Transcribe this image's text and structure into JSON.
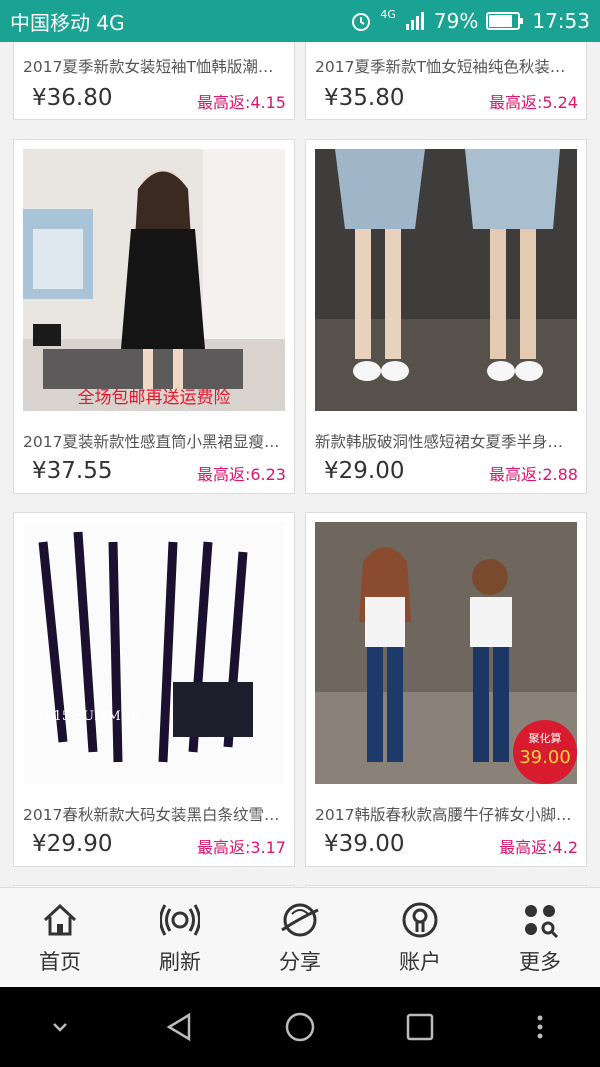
{
  "status": {
    "carrier": "中国移动 4G",
    "network": "4G",
    "battery": "79%",
    "time": "17:53"
  },
  "products": [
    {
      "title": "2017夏季新款女装短袖T恤韩版潮…",
      "price": "¥36.80",
      "rebate": "最高返:4.15"
    },
    {
      "title": "2017夏季新款T恤女短袖纯色秋装…",
      "price": "¥35.80",
      "rebate": "最高返:5.24"
    },
    {
      "title": "2017夏装新款性感直筒小黑裙显瘦…",
      "price": "¥37.55",
      "rebate": "最高返:6.23",
      "image_text": "全场包邮再送运费险"
    },
    {
      "title": "新款韩版破洞性感短裙女夏季半身…",
      "price": "¥29.00",
      "rebate": "最高返:2.88"
    },
    {
      "title": "2017春秋新款大码女装黑白条纹雪…",
      "price": "¥29.90",
      "rebate": "最高返:3.17",
      "image_text": "2015 SUMMER"
    },
    {
      "title": "2017韩版春秋款高腰牛仔裤女小脚…",
      "price": "¥39.00",
      "rebate": "最高返:4.2",
      "badge_label": "聚化算",
      "badge_price": "39.00"
    }
  ],
  "nav": [
    {
      "label": "首页",
      "icon": "home-icon"
    },
    {
      "label": "刷新",
      "icon": "refresh-icon"
    },
    {
      "label": "分享",
      "icon": "share-icon"
    },
    {
      "label": "账户",
      "icon": "account-icon"
    },
    {
      "label": "更多",
      "icon": "more-icon"
    }
  ],
  "colors": {
    "statusbar": "#1aa392",
    "rebate": "#e0156e"
  }
}
